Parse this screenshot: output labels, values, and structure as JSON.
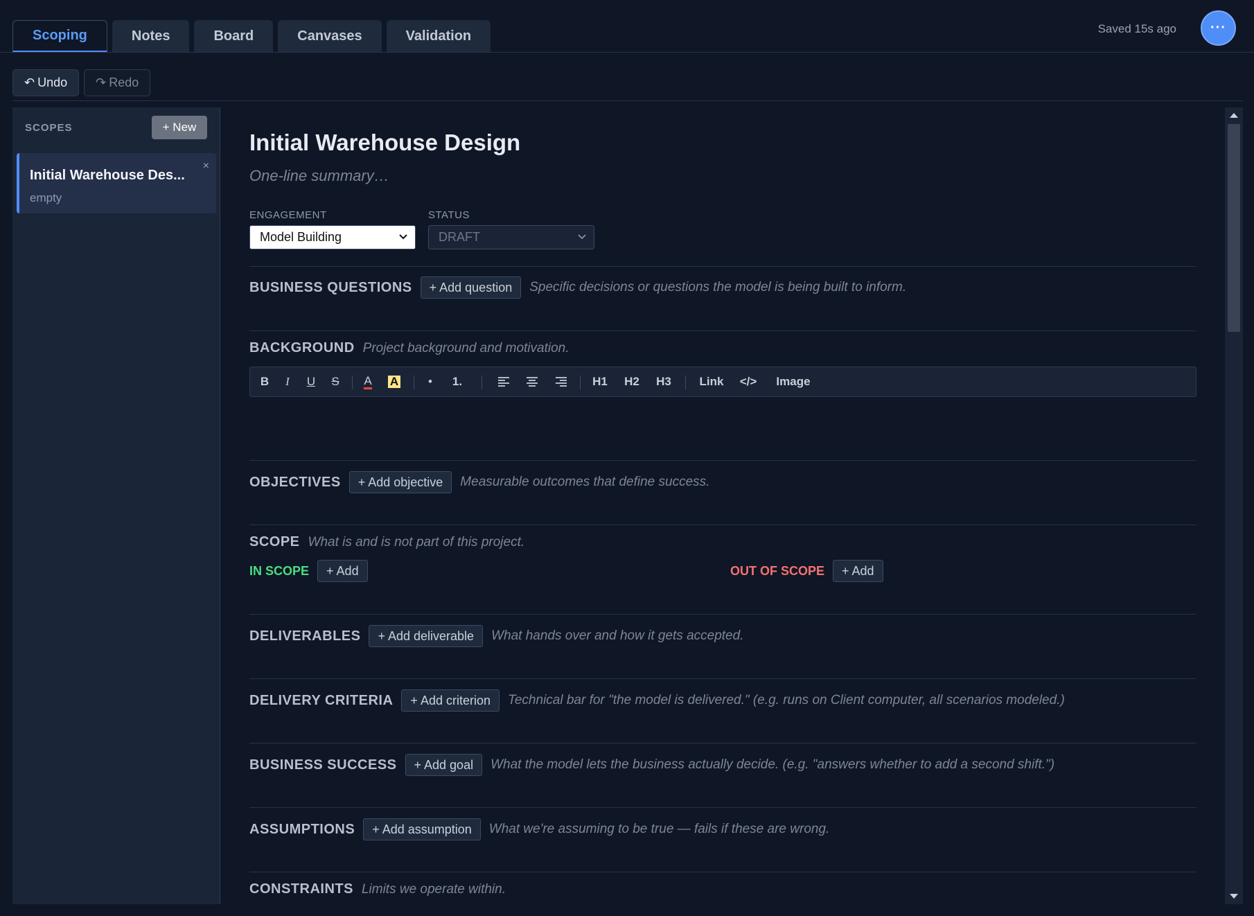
{
  "tabs": [
    "Scoping",
    "Notes",
    "Board",
    "Canvases",
    "Validation"
  ],
  "saved_status": "Saved 15s ago",
  "menu_label": "···",
  "history": {
    "undo": "Undo",
    "redo": "Redo",
    "undo_icon": "↶",
    "redo_icon": "↷"
  },
  "sidebar": {
    "heading": "SCOPES",
    "new_label": "+ New",
    "items": [
      {
        "title": "Initial Warehouse Des...",
        "subtitle": "empty",
        "close": "×"
      }
    ]
  },
  "doc": {
    "title": "Initial Warehouse Design",
    "summary_placeholder": "One-line summary…",
    "engagement_label": "ENGAGEMENT",
    "engagement_value": "Model Building",
    "status_label": "STATUS",
    "status_value": "DRAFT"
  },
  "sections": {
    "business_questions": {
      "title": "BUSINESS QUESTIONS",
      "add": "+ Add question",
      "hint": "Specific decisions or questions the model is being built to inform."
    },
    "background": {
      "title": "BACKGROUND",
      "hint": "Project background and motivation."
    },
    "objectives": {
      "title": "OBJECTIVES",
      "add": "+ Add objective",
      "hint": "Measurable outcomes that define success."
    },
    "scope": {
      "title": "SCOPE",
      "hint": "What is and is not part of this project.",
      "in_scope": "IN SCOPE",
      "out_scope": "OUT OF SCOPE",
      "add": "+ Add"
    },
    "deliverables": {
      "title": "DELIVERABLES",
      "add": "+ Add deliverable",
      "hint": "What hands over and how it gets accepted."
    },
    "delivery_criteria": {
      "title": "DELIVERY CRITERIA",
      "add": "+ Add criterion",
      "hint": "Technical bar for \"the model is delivered.\" (e.g. runs on Client computer, all scenarios modeled.)"
    },
    "business_success": {
      "title": "BUSINESS SUCCESS",
      "add": "+ Add goal",
      "hint": "What the model lets the business actually decide. (e.g. \"answers whether to add a second shift.\")"
    },
    "assumptions": {
      "title": "ASSUMPTIONS",
      "add": "+ Add assumption",
      "hint": "What we're assuming to be true — fails if these are wrong."
    },
    "constraints": {
      "title": "CONSTRAINTS",
      "hint": "Limits we operate within."
    }
  },
  "toolbar": {
    "bold": "B",
    "italic": "I",
    "underline": "U",
    "strike": "S",
    "text_color": "A",
    "highlight": "A",
    "bullet": "•",
    "numbered": "1.",
    "h1": "H1",
    "h2": "H2",
    "h3": "H3",
    "link": "Link",
    "code": "</>",
    "image": "Image"
  },
  "colors": {
    "accent": "#4f8ef7",
    "in_scope": "#4ade80",
    "out_scope": "#f87171",
    "text_color_bar": "#ef4444",
    "highlight_bg": "#fde68a"
  }
}
